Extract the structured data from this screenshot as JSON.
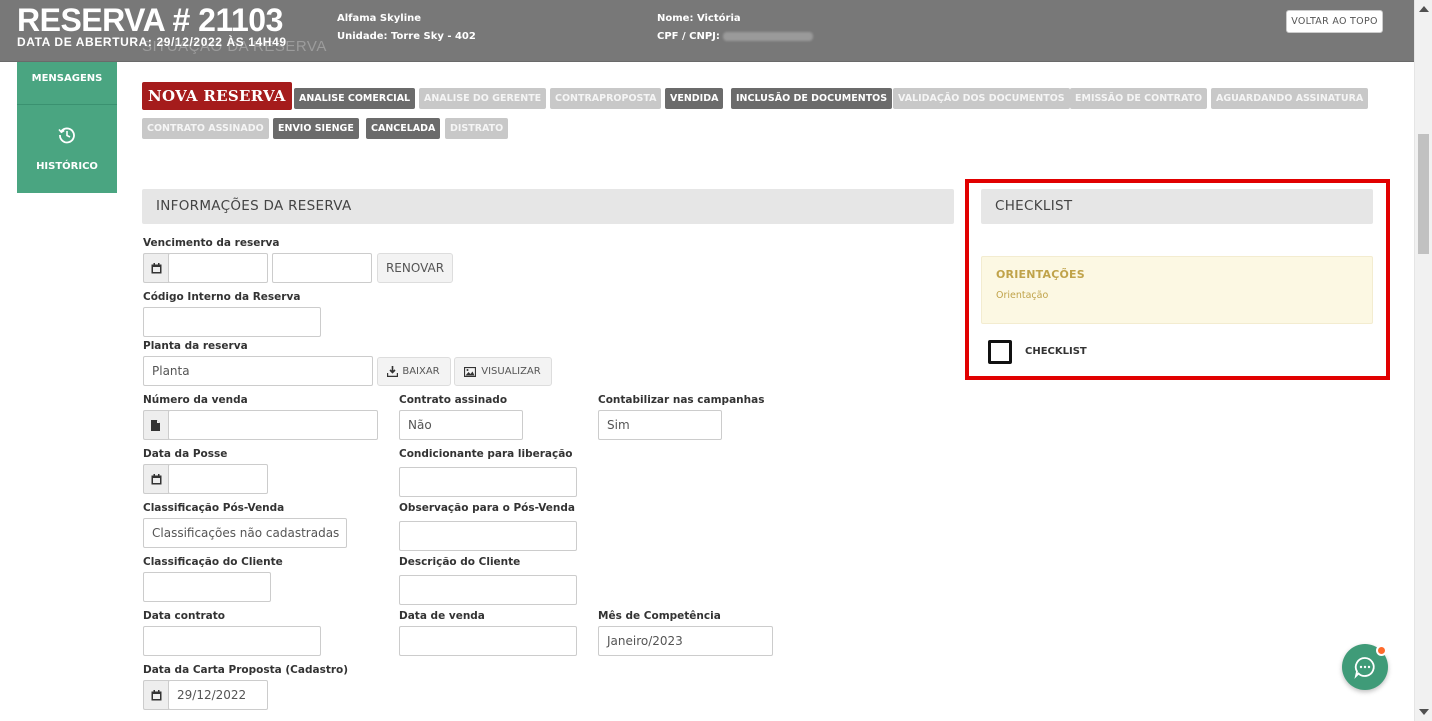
{
  "header": {
    "title": "RESERVA # 21103",
    "opening_date": "DATA DE ABERTURA: 29/12/2022 ÀS 14H49",
    "ghost_situation": "SITUAÇÃO DA RESERVA",
    "project": "Alfama Skyline",
    "unit_label": "Unidade:",
    "unit_value": "Torre Sky - 402",
    "name_label": "Nome:",
    "name_value": "Victória",
    "cpf_label": "CPF / CNPJ:",
    "back_to_top": "VOLTAR AO TOPO"
  },
  "sidebar": {
    "messages": "MENSAGENS",
    "history": "HISTÓRICO"
  },
  "statuses": [
    {
      "label": "NOVA RESERVA",
      "state": "current"
    },
    {
      "label": "ANALISE COMERCIAL",
      "state": "dark"
    },
    {
      "label": "ANALISE DO GERENTE",
      "state": "light"
    },
    {
      "label": "CONTRAPROPOSTA",
      "state": "light"
    },
    {
      "label": "VENDIDA",
      "state": "dark"
    },
    {
      "label": "INCLUSÃO DE DOCUMENTOS",
      "state": "dark"
    },
    {
      "label": "VALIDAÇÃO DOS DOCUMENTOS",
      "state": "light"
    },
    {
      "label": "EMISSÃO DE CONTRATO",
      "state": "light"
    },
    {
      "label": "AGUARDANDO ASSINATURA",
      "state": "light"
    },
    {
      "label": "CONTRATO ASSINADO",
      "state": "light"
    },
    {
      "label": "ENVIO SIENGE",
      "state": "dark"
    },
    {
      "label": "CANCELADA",
      "state": "dark"
    },
    {
      "label": "DISTRATO",
      "state": "light"
    }
  ],
  "info": {
    "heading": "INFORMAÇÕES DA RESERVA",
    "vencimento_label": "Vencimento da reserva",
    "renovar": "RENOVAR",
    "codigo_label": "Código Interno da Reserva",
    "planta_label": "Planta da reserva",
    "planta_value": "Planta",
    "baixar": "BAIXAR",
    "visualizar": "VISUALIZAR",
    "numero_venda_label": "Número da venda",
    "contrato_assinado_label": "Contrato assinado",
    "contrato_assinado_value": "Não",
    "contabilizar_label": "Contabilizar nas campanhas",
    "contabilizar_value": "Sim",
    "data_posse_label": "Data da Posse",
    "condicionante_label": "Condicionante para liberação",
    "classif_pos_label": "Classificação Pós-Venda",
    "classif_pos_value": "Classificações não cadastradas",
    "obs_pos_label": "Observação para o Pós-Venda",
    "classif_cliente_label": "Classificação do Cliente",
    "desc_cliente_label": "Descrição do Cliente",
    "data_contrato_label": "Data contrato",
    "data_venda_label": "Data de venda",
    "mes_competencia_label": "Mês de Competência",
    "mes_competencia_value": "Janeiro/2023",
    "data_carta_label": "Data da Carta Proposta (Cadastro)",
    "data_carta_value": "29/12/2022"
  },
  "checklist": {
    "heading": "CHECKLIST",
    "orient_title": "ORIENTAÇÕES",
    "orient_text": "Orientação",
    "item_label": "CHECKLIST"
  },
  "colors": {
    "header_bg": "#787878",
    "sidebar_green": "#4aa581",
    "current_status": "#a51c1c",
    "highlight_border": "#e10000"
  }
}
